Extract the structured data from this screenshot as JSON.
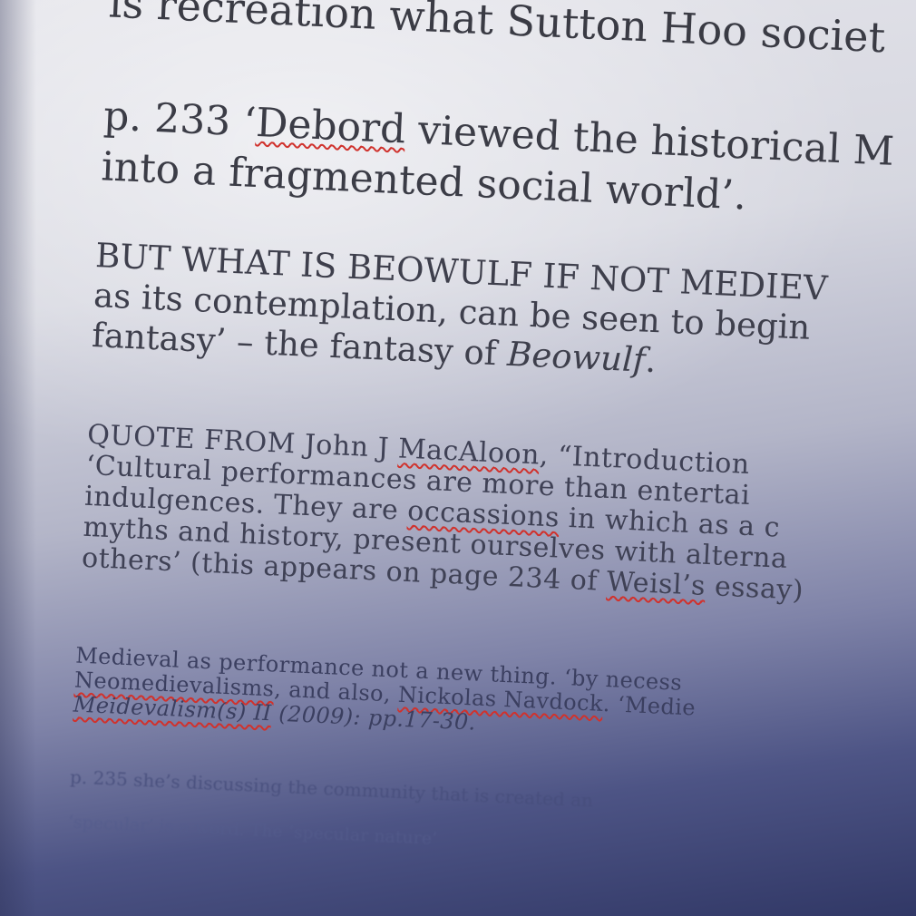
{
  "document": {
    "paragraphs": [
      {
        "lines": [
          [
            {
              "t": "is recreation what Sutton Hoo societ"
            }
          ]
        ]
      },
      {
        "lines": [
          [
            {
              "t": "p. 233 ‘"
            },
            {
              "t": "Debord",
              "spell": true
            },
            {
              "t": " viewed the historical M"
            }
          ],
          [
            {
              "t": "into a fragmented social world’."
            }
          ]
        ]
      },
      {
        "lines": [
          [
            {
              "t": "BUT WHAT IS BEOWULF IF NOT MEDIEV"
            }
          ],
          [
            {
              "t": "as its contemplation, can be seen to begin "
            }
          ],
          [
            {
              "t": "fantasy’ – the fantasy of "
            },
            {
              "t": "Beowulf",
              "italic": true
            },
            {
              "t": "."
            }
          ]
        ]
      },
      {
        "lines": [
          [
            {
              "t": "QUOTE FROM John J "
            },
            {
              "t": "MacAloon",
              "spell": true
            },
            {
              "t": ", “Introduction"
            }
          ],
          [
            {
              "t": "‘Cultural performances are more than entertai"
            }
          ],
          [
            {
              "t": "indulgences. They are "
            },
            {
              "t": "occassions",
              "spell": true
            },
            {
              "t": " in which as a c"
            }
          ],
          [
            {
              "t": "myths and history, present ourselves with alterna"
            }
          ],
          [
            {
              "t": "others’ (this appears on page 234 of "
            },
            {
              "t": "Weisl’s",
              "spell": true
            },
            {
              "t": " essay)"
            }
          ]
        ]
      },
      {
        "lines": [
          [
            {
              "t": "Medieval as performance not a new thing. ‘by necess"
            }
          ],
          [
            {
              "t": "Neomedievalisms",
              "spell": true
            },
            {
              "t": ", and also, "
            },
            {
              "t": "Nickolas Navdock",
              "spell": true
            },
            {
              "t": ". ‘Medie"
            }
          ],
          [
            {
              "t": "Meidevalism(s) II",
              "italic": true,
              "spell": true
            },
            {
              "t": " (2009): pp.17-30.",
              "italic": true
            }
          ]
        ]
      },
      {
        "lines": [
          [
            {
              "t": "p. 235 she’s discussing the community that is created an"
            }
          ]
        ]
      },
      {
        "lines": [
          [
            {
              "t": "‘specular’ is a word. The ‘specular nature’"
            }
          ]
        ]
      }
    ]
  }
}
